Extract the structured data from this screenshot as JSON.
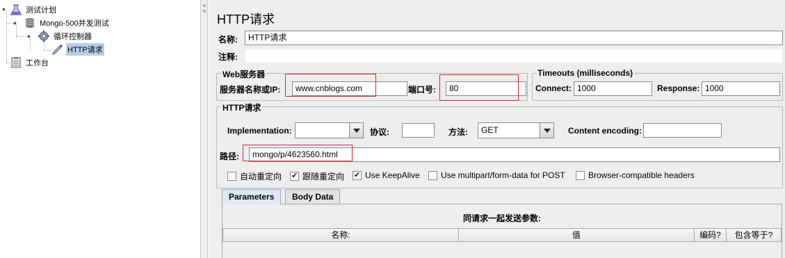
{
  "tree": {
    "nodes": [
      {
        "label": "测试计划",
        "icon": "beaker-icon"
      },
      {
        "label": "Mongo-500并发测试",
        "icon": "spool-icon"
      },
      {
        "label": "循环控制器",
        "icon": "gear-icon"
      },
      {
        "label": "HTTP请求",
        "icon": "pipette-icon"
      },
      {
        "label": "工作台",
        "icon": "clipboard-icon"
      }
    ]
  },
  "panel": {
    "title": "HTTP请求",
    "name_label": "名称:",
    "name_value": "HTTP请求",
    "comment_label": "注释:",
    "comment_value": ""
  },
  "web_server": {
    "group_title": "Web服务器",
    "server_label": "服务器名称或IP:",
    "server_value": "www.cnblogs.com",
    "port_label": "端口号:",
    "port_value": "80"
  },
  "timeouts": {
    "group_title": "Timeouts (milliseconds)",
    "connect_label": "Connect:",
    "connect_value": "1000",
    "response_label": "Response:",
    "response_value": "1000"
  },
  "http_request": {
    "group_title": "HTTP请求",
    "implementation_label": "Implementation:",
    "implementation_value": "",
    "protocol_label": "协议:",
    "protocol_value": "",
    "method_label": "方法:",
    "method_value": "GET",
    "encoding_label": "Content encoding:",
    "encoding_value": "",
    "path_label": "路径:",
    "path_value": "mongo/p/4623560.html"
  },
  "options": [
    {
      "label": "自动重定向",
      "checked": false
    },
    {
      "label": "跟随重定向",
      "checked": true
    },
    {
      "label": "Use KeepAlive",
      "checked": true
    },
    {
      "label": "Use multipart/form-data for POST",
      "checked": false
    },
    {
      "label": "Browser-compatible headers",
      "checked": false
    }
  ],
  "tabs": [
    {
      "label": "Parameters",
      "active": true
    },
    {
      "label": "Body Data",
      "active": false
    }
  ],
  "params_table": {
    "caption": "同请求一起发送参数:",
    "columns": [
      "名称:",
      "值",
      "编码?",
      "包含等于?"
    ]
  },
  "colors": {
    "highlight": "#d9232b",
    "selection": "#b8cfe5",
    "background": "#eeeeee"
  }
}
